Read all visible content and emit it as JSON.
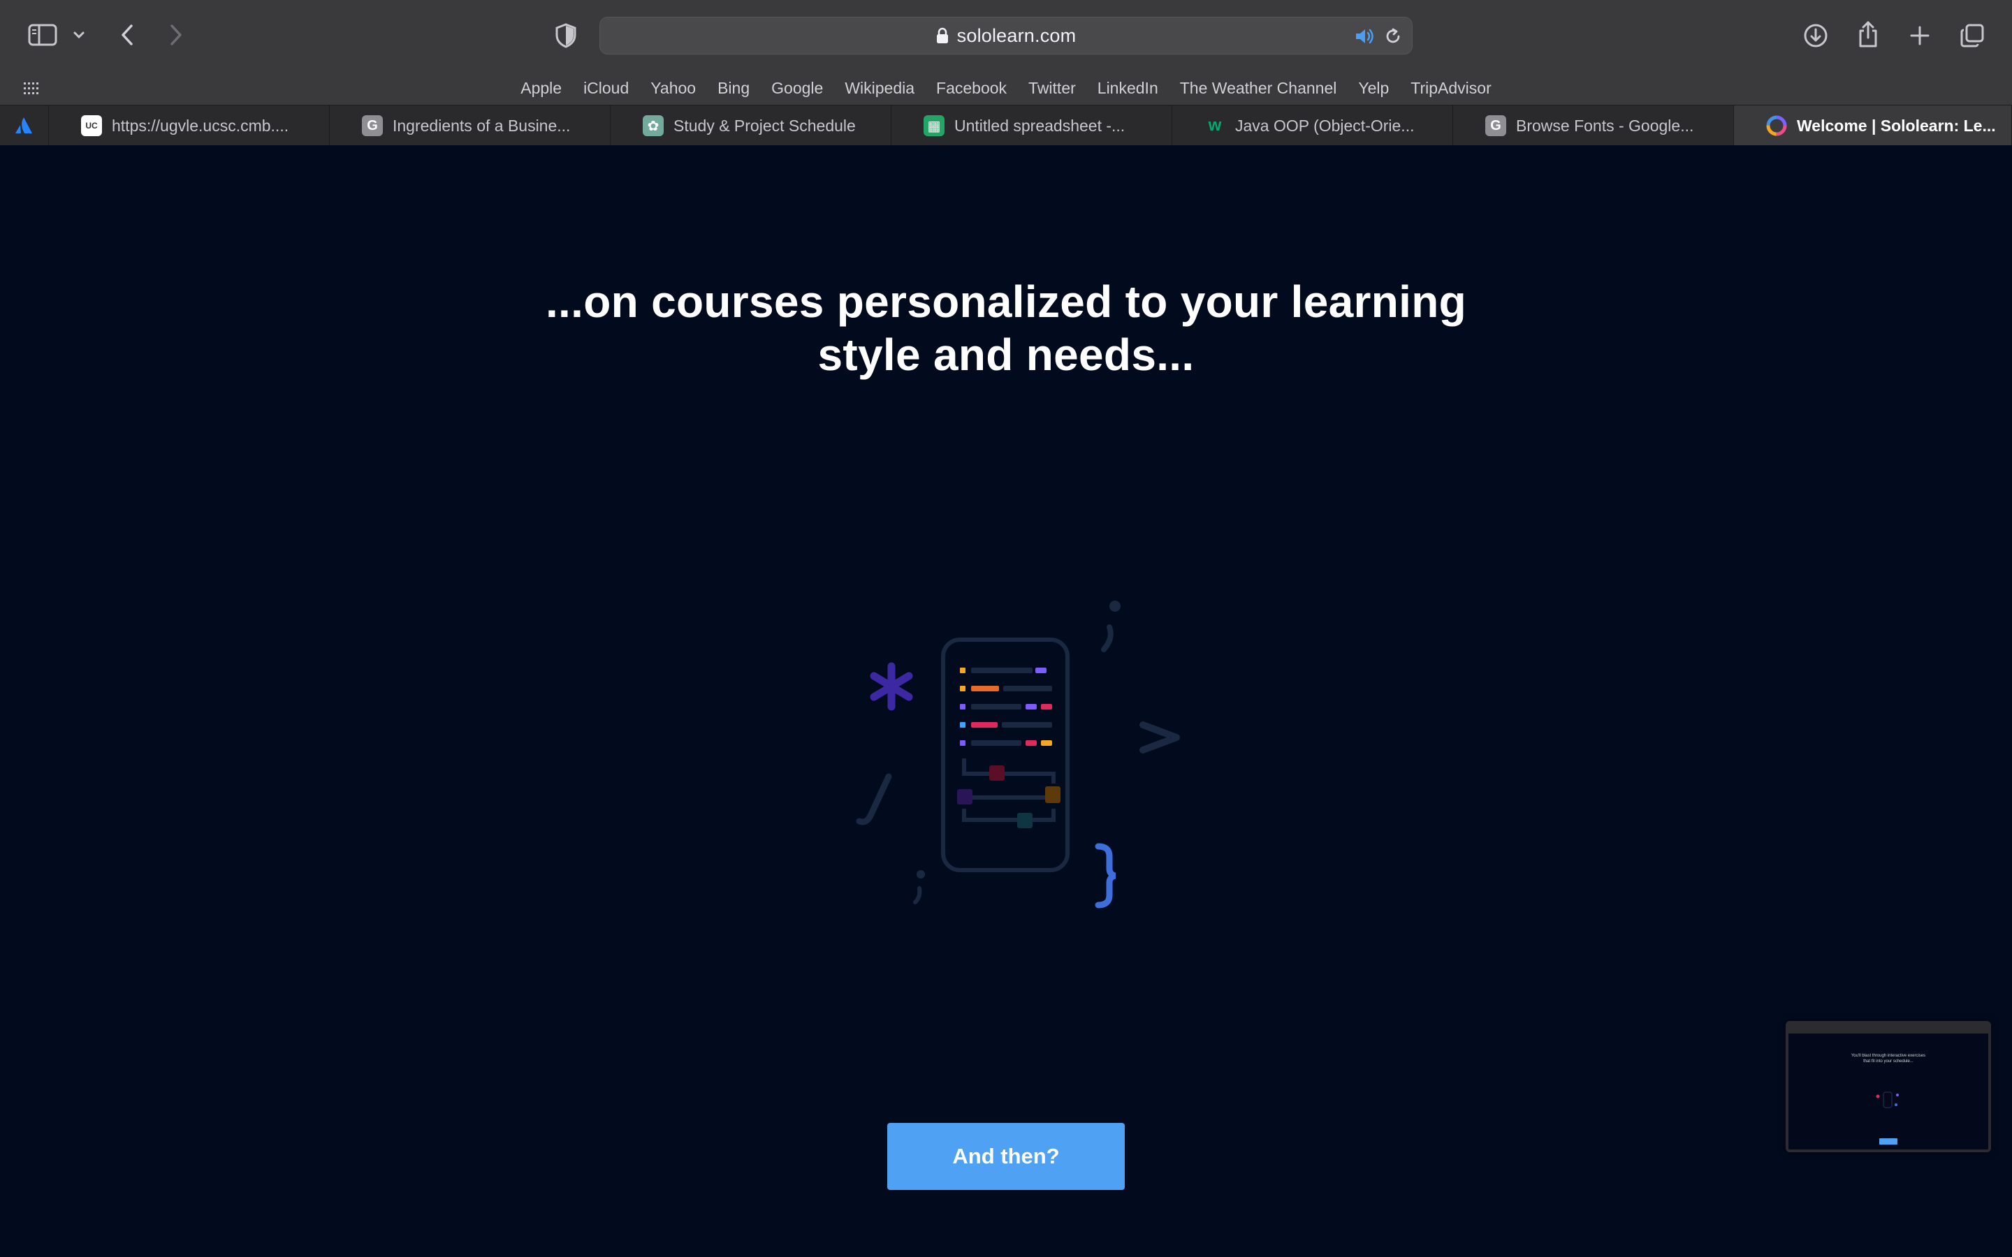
{
  "browser": {
    "url": "sololearn.com",
    "favorites": [
      "Apple",
      "iCloud",
      "Yahoo",
      "Bing",
      "Google",
      "Wikipedia",
      "Facebook",
      "Twitter",
      "LinkedIn",
      "The Weather Channel",
      "Yelp",
      "TripAdvisor"
    ],
    "tabs": [
      {
        "label": "https://ugvle.ucsc.cmb....",
        "icon": "ucsc-icon"
      },
      {
        "label": "Ingredients of a Busine...",
        "icon": "google-docs-g-icon"
      },
      {
        "label": "Study & Project Schedule",
        "icon": "chatgpt-icon"
      },
      {
        "label": "Untitled spreadsheet -...",
        "icon": "google-sheets-icon"
      },
      {
        "label": "Java OOP (Object-Orie...",
        "icon": "w3schools-icon"
      },
      {
        "label": "Browse Fonts - Google...",
        "icon": "google-fonts-g-icon"
      },
      {
        "label": "Welcome | Sololearn: Le...",
        "icon": "sololearn-icon"
      }
    ],
    "active_tab_index": 6
  },
  "page": {
    "headline_line1": "...on courses personalized to your learning",
    "headline_line2": "style and needs...",
    "cta_label": "And then?",
    "thumbnail": {
      "text_line1": "You'll blast through interactive exercises",
      "text_line2": "that fit into your schedule..."
    }
  },
  "colors": {
    "page_background": "#020b1d",
    "cta_background": "#4fa1f4",
    "toolbar": "#3a3a3c"
  }
}
